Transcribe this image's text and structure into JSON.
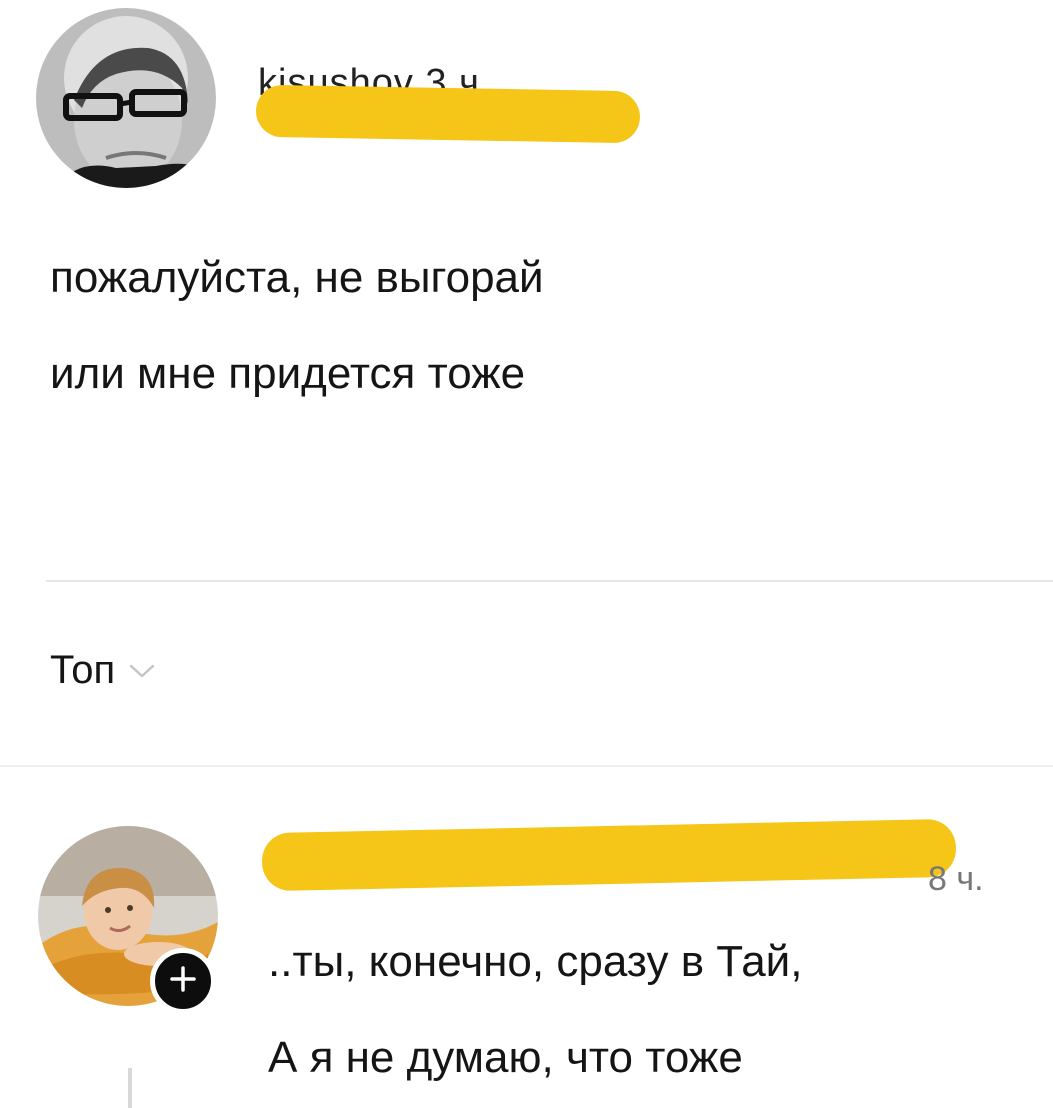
{
  "post": {
    "username_fragment": "kisushov 3 ч",
    "text_line_1": "пожалуйста, не выгорай",
    "text_line_2": "или мне придется тоже"
  },
  "sort": {
    "label": "Топ",
    "chevron_icon": "chevron-down-icon"
  },
  "comment": {
    "username_fragment": "",
    "time": "8 ч.",
    "text_line_1": "..ты, конечно, сразу в Тай,",
    "text_line_2": "А я не думаю, что тоже",
    "follow_icon": "plus-icon"
  },
  "colors": {
    "redaction": "#f5c518",
    "text": "#151515",
    "muted": "#777777",
    "divider": "#e6e6e6"
  }
}
